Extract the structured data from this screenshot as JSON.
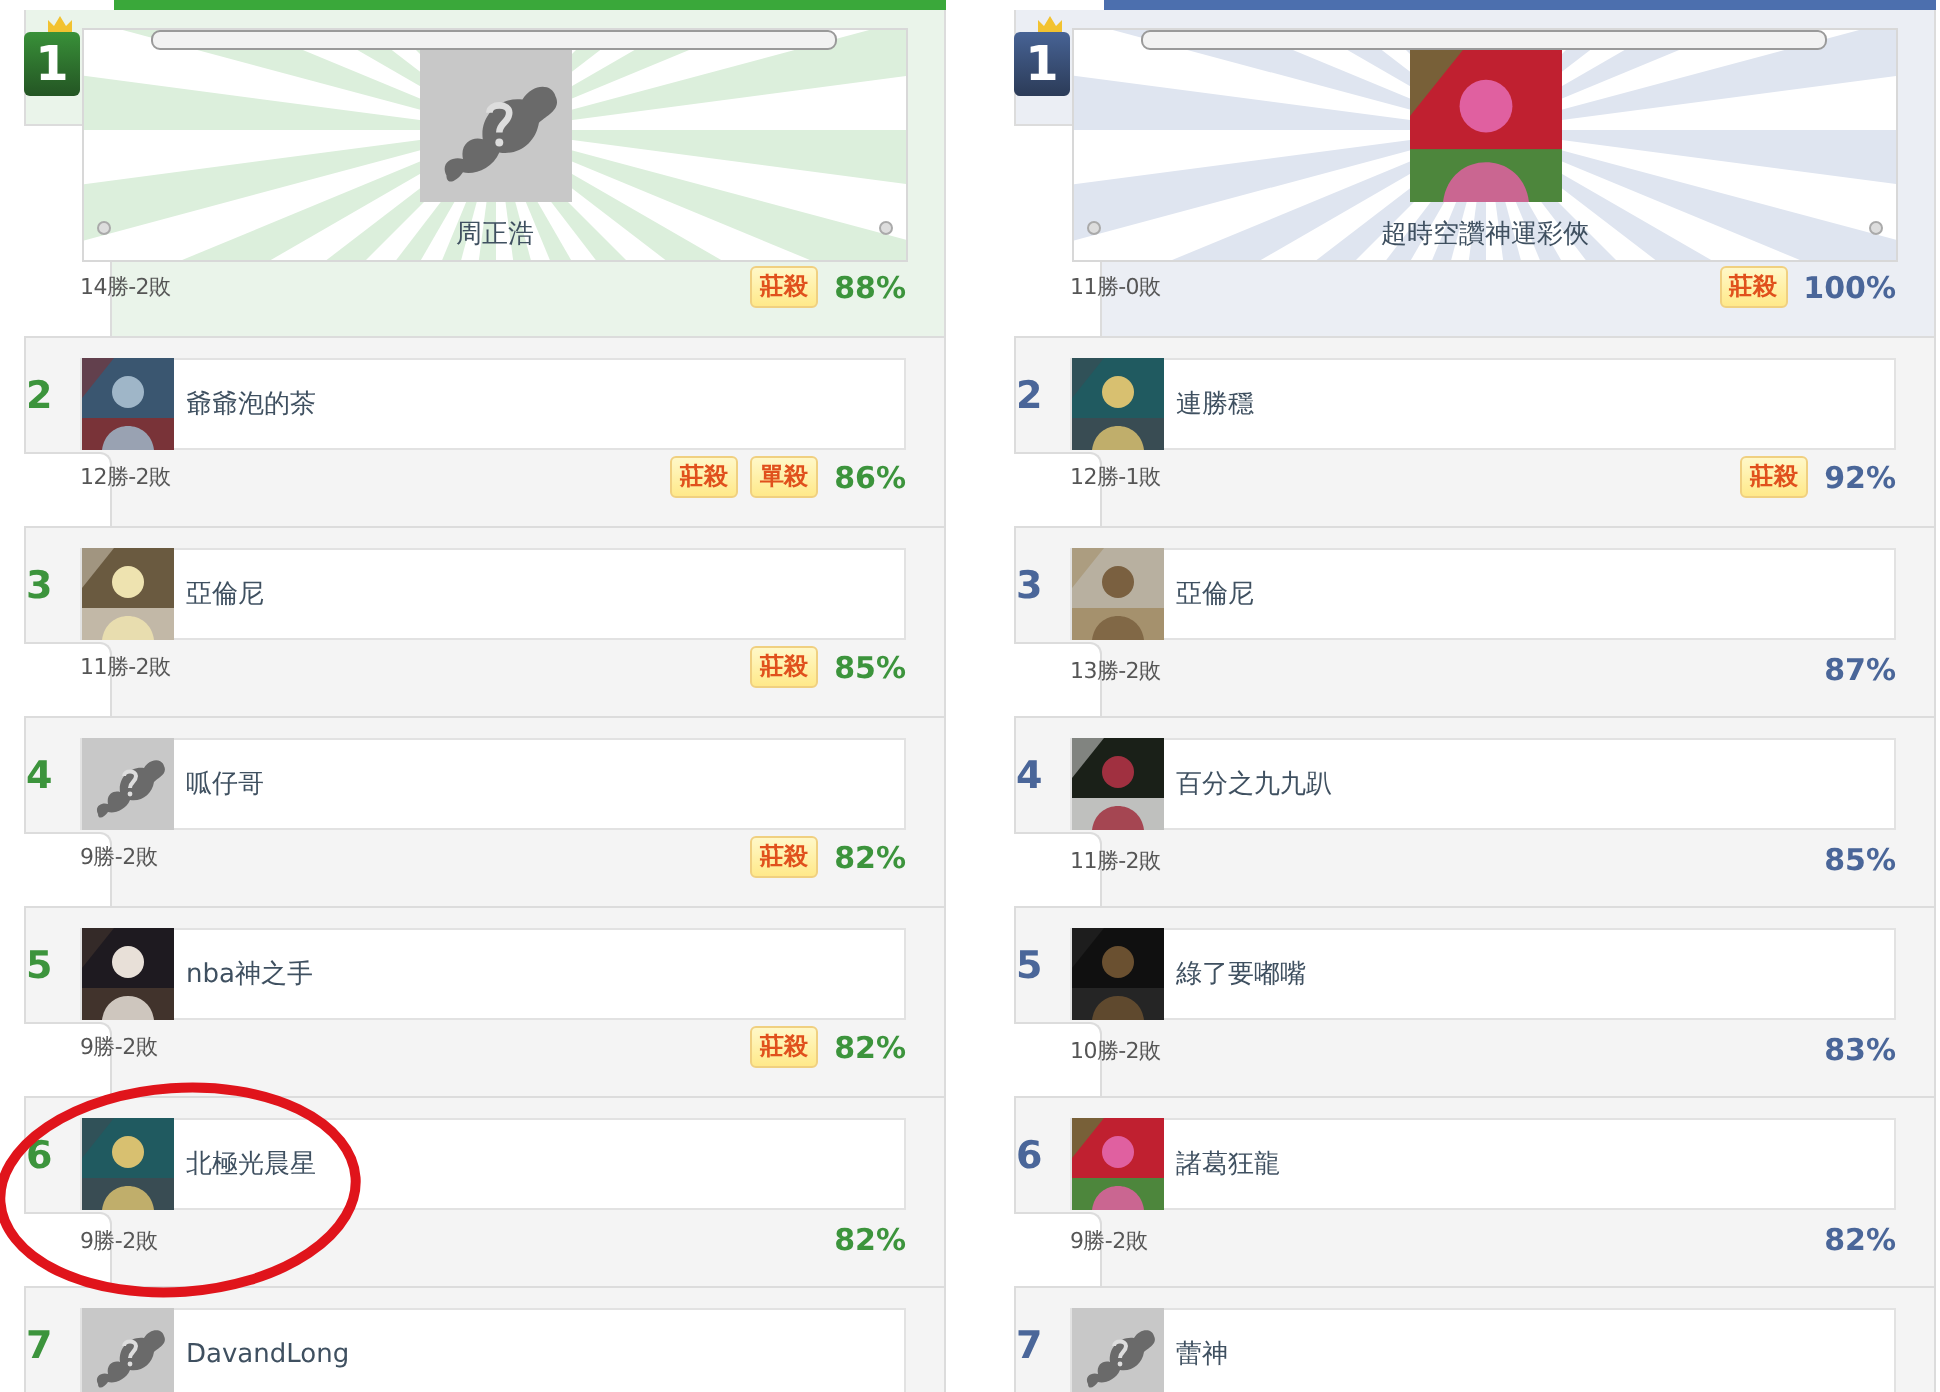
{
  "columns": [
    {
      "color": "#3aa83a",
      "leader": {
        "rank": "1",
        "name": "周正浩",
        "kind": "placeholder",
        "record": "14勝-2敗",
        "badges": [
          "莊殺"
        ],
        "percent": "88%"
      },
      "rows": [
        {
          "rank": "2",
          "name": "爺爺泡的茶",
          "record": "12勝-2敗",
          "badges": [
            "莊殺",
            "單殺"
          ],
          "percent": "86%"
        },
        {
          "rank": "3",
          "name": "亞倫尼",
          "record": "11勝-2敗",
          "badges": [
            "莊殺"
          ],
          "percent": "85%"
        },
        {
          "rank": "4",
          "name": "呱仔哥",
          "kind": "placeholder",
          "record": "9勝-2敗",
          "badges": [
            "莊殺"
          ],
          "percent": "82%"
        },
        {
          "rank": "5",
          "name": "nba神之手",
          "record": "9勝-2敗",
          "badges": [
            "莊殺"
          ],
          "percent": "82%"
        },
        {
          "rank": "6",
          "name": "北極光晨星",
          "record": "9勝-2敗",
          "percent": "82%"
        },
        {
          "rank": "7",
          "name": "DavandLong",
          "kind": "placeholder"
        }
      ]
    },
    {
      "color": "#4c6fae",
      "leader": {
        "rank": "1",
        "name": "超時空讚神運彩俠",
        "record": "11勝-0敗",
        "badges": [
          "莊殺"
        ],
        "percent": "100%"
      },
      "rows": [
        {
          "rank": "2",
          "name": "連勝穩",
          "record": "12勝-1敗",
          "badges": [
            "莊殺"
          ],
          "percent": "92%"
        },
        {
          "rank": "3",
          "name": "亞倫尼",
          "record": "13勝-2敗",
          "percent": "87%"
        },
        {
          "rank": "4",
          "name": "百分之九九趴",
          "record": "11勝-2敗",
          "percent": "85%"
        },
        {
          "rank": "5",
          "name": "綠了要嘟嘴",
          "record": "10勝-2敗",
          "percent": "83%"
        },
        {
          "rank": "6",
          "name": "諸葛狂龍",
          "record": "9勝-2敗",
          "percent": "82%"
        },
        {
          "rank": "7",
          "name": "蕾神",
          "kind": "placeholder"
        }
      ]
    }
  ],
  "annotation": {
    "kind": "ellipse",
    "color": "#e0141b"
  }
}
